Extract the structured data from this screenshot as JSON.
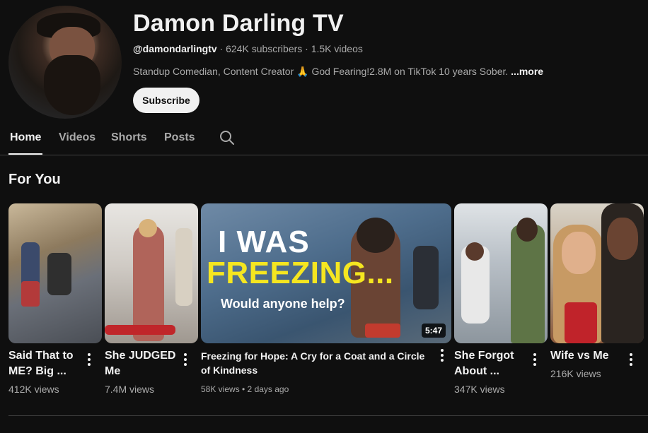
{
  "channel": {
    "name": "Damon Darling TV",
    "handle": "@damondarlingtv",
    "stats": " · 624K subscribers · 1.5K videos",
    "description": "Standup Comedian, Content Creator 🙏 God Fearing!2.8M on TikTok 10 years Sober. ",
    "more_label": "...more",
    "subscribe_label": "Subscribe"
  },
  "tabs": [
    {
      "label": "Home",
      "active": true
    },
    {
      "label": "Videos"
    },
    {
      "label": "Shorts"
    },
    {
      "label": "Posts"
    }
  ],
  "section": {
    "title": "For You"
  },
  "videos": [
    {
      "title": "Said That to ME? Big ...",
      "views": "412K views"
    },
    {
      "title": "She JUDGED Me",
      "views": "7.4M views"
    },
    {
      "title": "Freezing for Hope: A Cry for a Coat and a Circle of Kindness",
      "views": "58K views • 2 days ago",
      "duration": "5:47",
      "thumb_text": {
        "line1": "I WAS",
        "line2": "FREEZING...",
        "line3": "Would anyone help?"
      }
    },
    {
      "title": "She Forgot About ...",
      "views": "347K views"
    },
    {
      "title": "Wife vs Me",
      "views": "216K views"
    }
  ],
  "icons": {
    "search": "search-icon",
    "more": "more-vert-icon"
  },
  "colors": {
    "background": "#0f0f0f",
    "text": "#f1f1f1",
    "secondary": "#aaaaaa",
    "thumb_yellow": "#f5e620"
  }
}
